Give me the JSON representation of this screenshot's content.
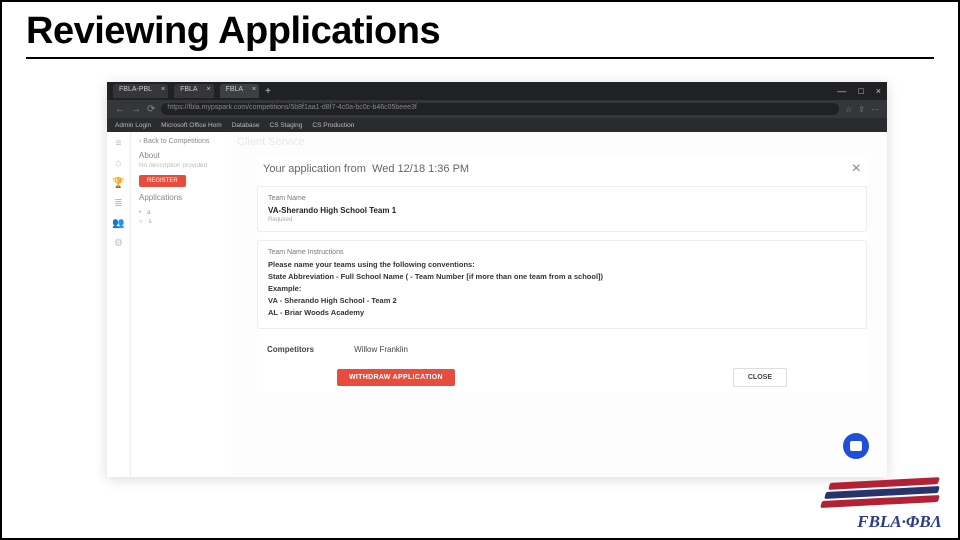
{
  "slide": {
    "title": "Reviewing Applications"
  },
  "browser": {
    "tabs": [
      {
        "label": "FBLA-PBL"
      },
      {
        "label": "FBLA"
      },
      {
        "label": "FBLA"
      }
    ],
    "url": "https://fbla.mypspark.com/competitions/5b8f1aa1-d8f7-4c0a-bc0c-b46c05beee3f",
    "bookmarks": [
      "Admin Login",
      "Microsoft Office Hom",
      "Database",
      "CS Staging",
      "CS Production"
    ]
  },
  "page": {
    "back": "‹ Back to Competitions",
    "heading": "Client Service",
    "about": "About",
    "about_body": "No description provided",
    "register": "REGISTER",
    "applications_label": "Applications"
  },
  "modal": {
    "title_prefix": "Your application from",
    "title_date": "Wed 12/18 1:36 PM",
    "team_name_label": "Team Name",
    "team_name_value": "VA-Sherando High School Team 1",
    "required": "Required",
    "instructions_label": "Team Name Instructions",
    "instructions_line1": "Please name your teams using the following conventions:",
    "instructions_line2": "State Abbreviation - Full School Name ( - Team Number [if more than one team from a school])",
    "example_label": "Example:",
    "example1": "VA - Sherando High School - Team 2",
    "example2": "AL - Briar Woods Academy",
    "competitors_label": "Competitors",
    "competitors_value": "Willow Franklin",
    "withdraw": "WITHDRAW APPLICATION",
    "close": "CLOSE"
  },
  "logo": {
    "text": "FBLA·ΦBΛ"
  }
}
